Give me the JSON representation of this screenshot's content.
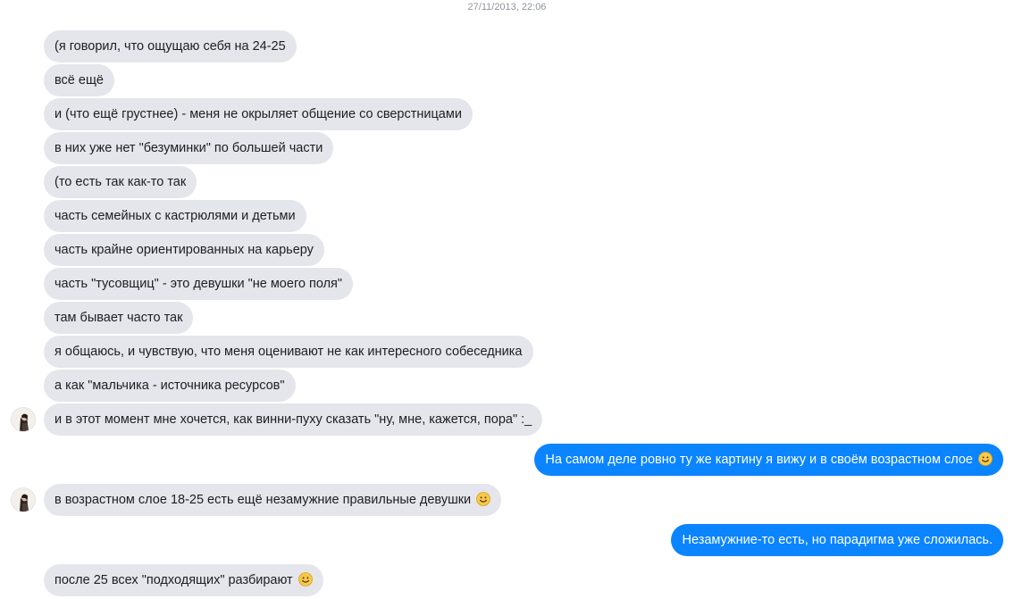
{
  "timestamp": "27/11/2013, 22:06",
  "messages": [
    {
      "dir": "in",
      "text": "(я говорил, что ощущаю себя на 24-25"
    },
    {
      "dir": "in",
      "text": "всё ещё"
    },
    {
      "dir": "in",
      "text": "и (что ещё грустнее) - меня не окрыляет общение со сверстницами"
    },
    {
      "dir": "in",
      "text": "в них уже нет \"безуминки\" по большей части"
    },
    {
      "dir": "in",
      "text": "(то есть так как-то так"
    },
    {
      "dir": "in",
      "text": "часть семейных с кастрюлями и детьми"
    },
    {
      "dir": "in",
      "text": "часть крайне ориентированных на карьеру"
    },
    {
      "dir": "in",
      "text": "часть \"тусовщиц\" - это девушки \"не моего поля\""
    },
    {
      "dir": "in",
      "text": "там бывает часто так"
    },
    {
      "dir": "in",
      "text": "я общаюсь, и чувствую, что меня оценивают не как интересного собеседника"
    },
    {
      "dir": "in",
      "text": "а как \"мальчика - источника ресурсов\""
    },
    {
      "dir": "in",
      "text": "и в этот момент мне хочется, как винни-пуху сказать \"ну, мне, кажется, пора\" :_",
      "avatar": true
    },
    {
      "dir": "out",
      "text": "На самом деле ровно ту же картину я вижу и в своём возрастном слое",
      "emoji": "smile-emoji"
    },
    {
      "dir": "in",
      "text": "в возрастном слое 18-25 есть ещё незамужние правильные девушки",
      "emoji": "smile-emoji",
      "avatar": true
    },
    {
      "dir": "out",
      "text": "Незамужние-то есть, но парадигма уже сложилась."
    },
    {
      "dir": "in",
      "text": "после 25 всех \"подходящих\" разбирают",
      "emoji": "smile-emoji"
    }
  ],
  "colors": {
    "incoming_bubble": "#e4e6eb",
    "outgoing_bubble": "#0a84ff",
    "timestamp": "#90949c"
  }
}
